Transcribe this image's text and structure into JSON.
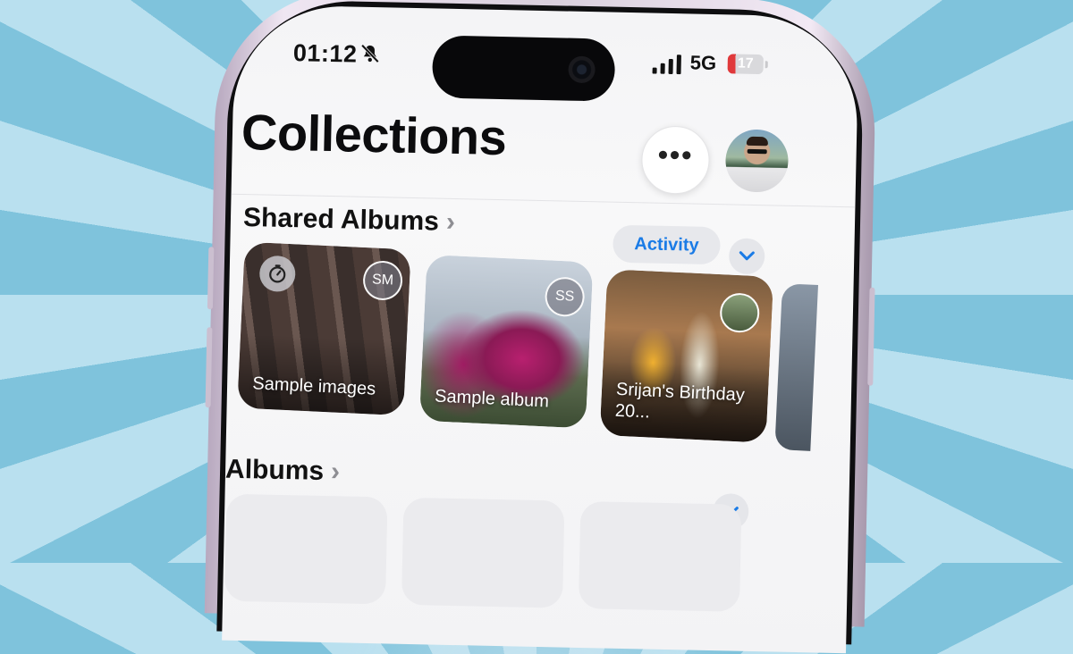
{
  "status_bar": {
    "time": "01:12",
    "network": "5G",
    "battery": "17"
  },
  "header": {
    "title": "Collections",
    "more_label": "•••"
  },
  "shared_albums": {
    "title": "Shared Albums",
    "chevron": "›",
    "activity_label": "Activity",
    "albums": [
      {
        "label": "Sample images",
        "badge": "SM"
      },
      {
        "label": "Sample album",
        "badge": "SS"
      },
      {
        "label": "Srijan's Birthday 20..."
      }
    ]
  },
  "albums": {
    "title": "Albums",
    "chevron": "›"
  },
  "icons": [
    "bell-slash-icon",
    "signal-icon",
    "battery-icon",
    "more-icon",
    "avatar",
    "chevron-right-icon",
    "chevron-down-icon",
    "timer-icon"
  ],
  "colors": {
    "accent": "#1a7be6",
    "battery_low": "#e0393b"
  }
}
